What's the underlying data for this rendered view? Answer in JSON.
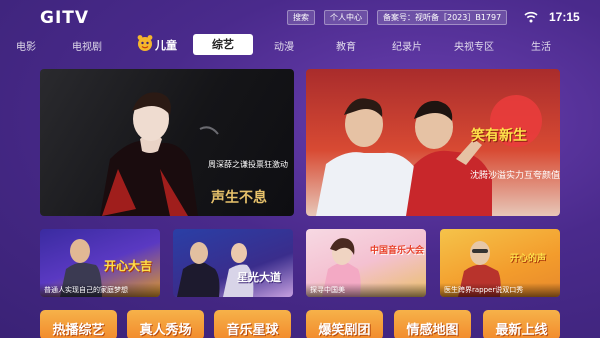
{
  "header": {
    "logo": "GITV",
    "search_label": "搜索",
    "profile_label": "个人中心",
    "license_label": "备案号：视听备［2023］B1797",
    "time": "17:15"
  },
  "nav": {
    "tabs": [
      {
        "label": "电影"
      },
      {
        "label": "电视剧"
      },
      {
        "label": "儿童"
      },
      {
        "label": "综艺",
        "active": true
      },
      {
        "label": "动漫"
      },
      {
        "label": "教育"
      },
      {
        "label": "纪录片"
      },
      {
        "label": "央视专区"
      },
      {
        "label": "生活"
      }
    ]
  },
  "featured": [
    {
      "title": "周深薛之谦投票狂激动",
      "overlay": "声生不息"
    },
    {
      "title": "沈腾沙溢实力互夸颜值",
      "overlay": "笑有新生"
    }
  ],
  "shows": [
    {
      "overlay": "开心大吉",
      "caption": "普通人实现自己的家庭梦想"
    },
    {
      "overlay": "星光大道",
      "caption": ""
    },
    {
      "overlay": "中国音乐大会",
      "caption": "探寻中国美"
    },
    {
      "overlay": "开心的声",
      "caption": "医生跨界rapper说双口秀"
    }
  ],
  "categories": [
    {
      "label": "热播综艺"
    },
    {
      "label": "真人秀场"
    },
    {
      "label": "音乐星球"
    },
    {
      "label": "爆笑剧团"
    },
    {
      "label": "情感地图"
    },
    {
      "label": "最新上线"
    }
  ],
  "colors": {
    "background": "#4a2a8c",
    "category_button": "#f28a2c",
    "active_tab": "#ffffff"
  }
}
